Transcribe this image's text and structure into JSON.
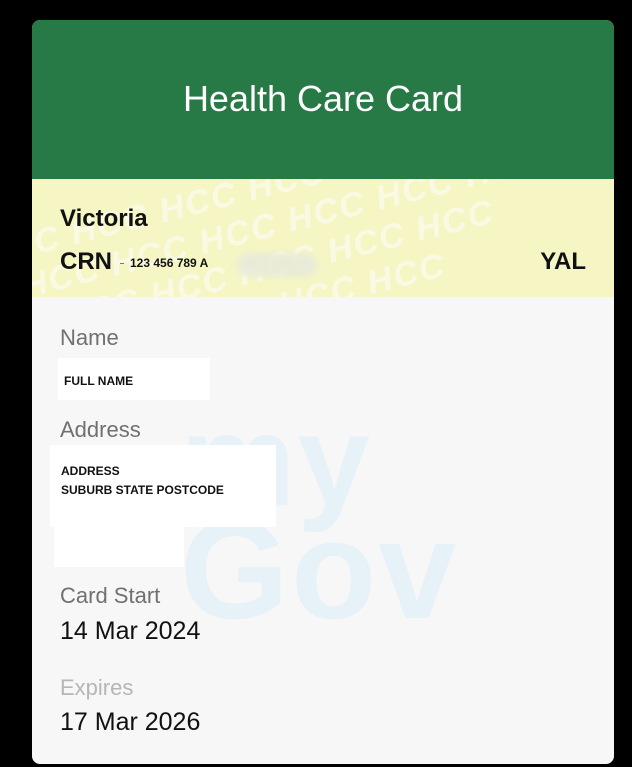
{
  "card": {
    "title": "Health Care Card",
    "watermark_band": "HCC HCC HCC HCC HCC HCC HCC",
    "state": "Victoria",
    "crn_label": "CRN",
    "crn_value": "123 456 789 A",
    "code": "YAL",
    "watermark_logo": {
      "line1": "my",
      "line2": "Gov"
    },
    "name_label": "Name",
    "name_value": "FULL NAME",
    "address_label": "Address",
    "address_line1": "ADDRESS",
    "address_line2": "SUBURB STATE POSTCODE",
    "card_start_label": "Card Start",
    "card_start_value": "14 Mar 2024",
    "expires_label": "Expires",
    "expires_value": "17 Mar 2026"
  },
  "colors": {
    "header_green": "#277a45",
    "band_yellow": "#f5f6c4",
    "card_bg": "#f7f7f7"
  }
}
